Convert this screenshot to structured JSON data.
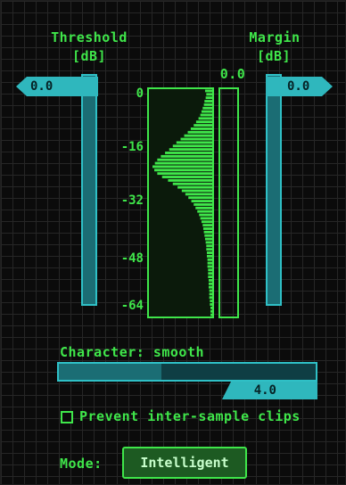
{
  "threshold": {
    "title": "Threshold",
    "unit": "[dB]",
    "value": "0.0",
    "level": 1.0
  },
  "margin": {
    "title": "Margin",
    "unit": "[dB]",
    "value": "0.0",
    "level": 1.0
  },
  "meter": {
    "peak_value": "0.0",
    "scale": [
      "0",
      "-16",
      "-32",
      "-48",
      "-64"
    ],
    "histogram": [
      0.12,
      0.1,
      0.11,
      0.13,
      0.14,
      0.16,
      0.18,
      0.2,
      0.23,
      0.27,
      0.31,
      0.36,
      0.41,
      0.47,
      0.53,
      0.6,
      0.66,
      0.72,
      0.79,
      0.86,
      0.92,
      0.96,
      1.0,
      0.97,
      0.92,
      0.84,
      0.74,
      0.66,
      0.58,
      0.51,
      0.45,
      0.4,
      0.35,
      0.31,
      0.28,
      0.25,
      0.22,
      0.2,
      0.18,
      0.16,
      0.15,
      0.14,
      0.13,
      0.12,
      0.11,
      0.1,
      0.1,
      0.09,
      0.09,
      0.08,
      0.08,
      0.08,
      0.07,
      0.07,
      0.07,
      0.06,
      0.06,
      0.06,
      0.05,
      0.05,
      0.05,
      0.04,
      0.04,
      0.03,
      0.03,
      0.03
    ]
  },
  "character": {
    "label": "Character: smooth",
    "value": "4.0",
    "level": 0.4
  },
  "prevent_clips": {
    "label": "Prevent inter-sample clips",
    "checked": false
  },
  "mode": {
    "label": "Mode:",
    "button": "Intelligent"
  },
  "colors": {
    "green": "#3fe64a",
    "teal": "#2fc0c6",
    "background": "#0b0b0b"
  }
}
